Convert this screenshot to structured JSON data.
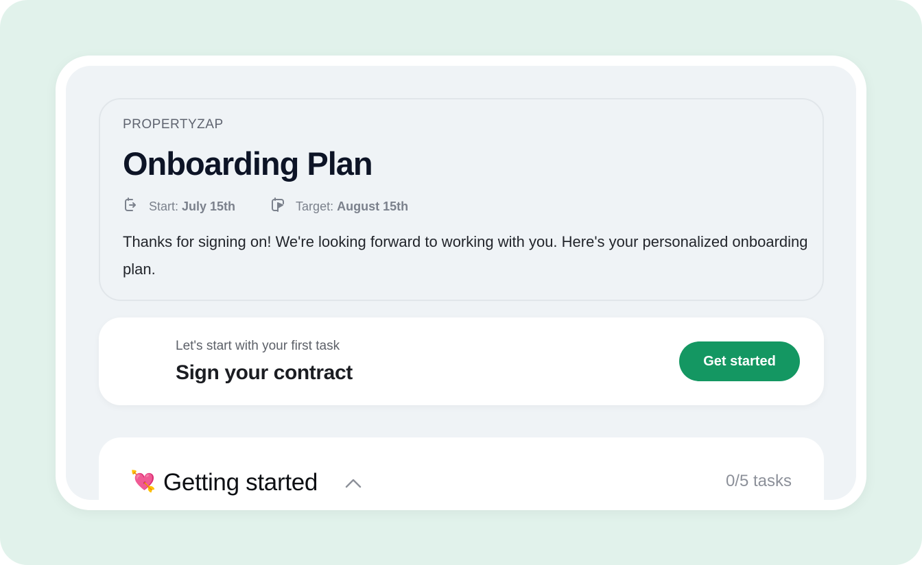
{
  "plan": {
    "company": "PROPERTYZAP",
    "title": "Onboarding Plan",
    "start_label": "Start:",
    "start_date": "July 15th",
    "target_label": "Target:",
    "target_date": "August 15th",
    "intro": "Thanks for signing on! We're looking forward to working with you. Here's your personalized onboarding plan."
  },
  "first_task": {
    "kicker": "Let's start with your first task",
    "title": "Sign your contract",
    "button_label": "Get started"
  },
  "section": {
    "emoji": "💘",
    "title": "Getting started",
    "count": "0/5 tasks"
  },
  "colors": {
    "backdrop": "#e1f2eb",
    "panel": "#eff3f6",
    "accent": "#149762",
    "title": "#0d1426"
  },
  "icons": {
    "start": "calendar-arrow-icon",
    "target": "calendar-flag-icon",
    "chevron": "chevron-up-icon"
  }
}
